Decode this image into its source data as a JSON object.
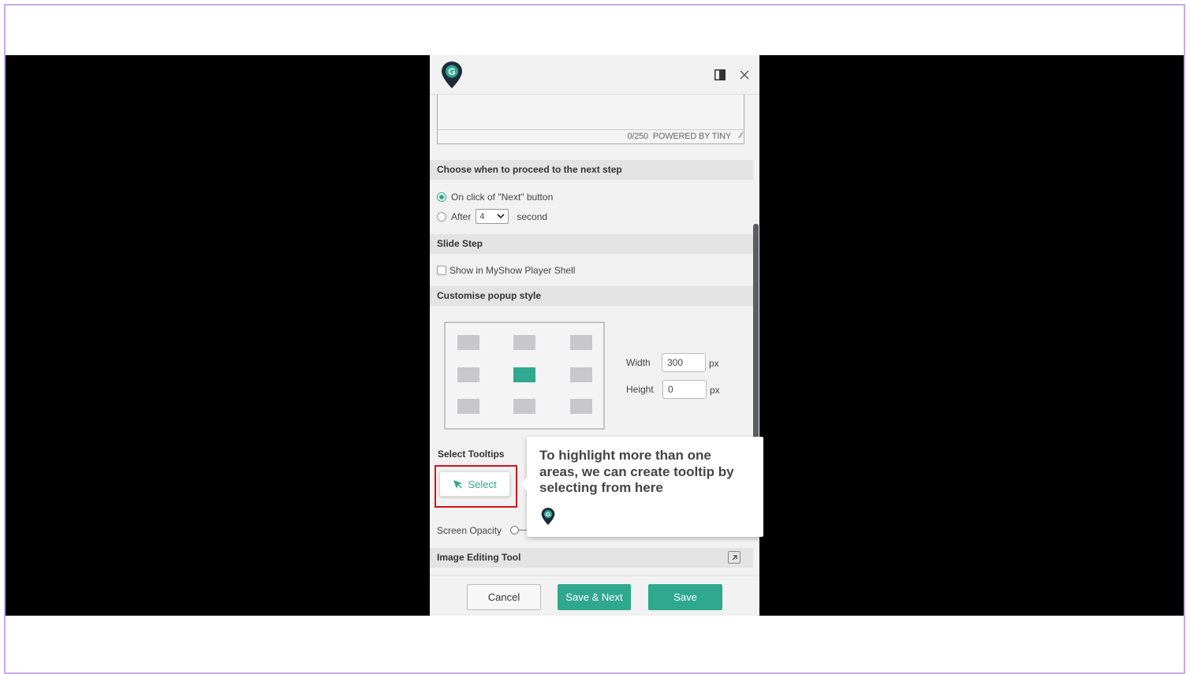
{
  "editor": {
    "char_count": "0/250",
    "powered_by": "POWERED BY TINY"
  },
  "proceed": {
    "heading": "Choose when to proceed to the next step",
    "option_next": "On click of \"Next\" button",
    "option_after": "After",
    "after_value": "4",
    "after_unit": "second"
  },
  "slide_step": {
    "heading": "Slide Step",
    "show_in_player": "Show in MyShow Player Shell"
  },
  "popup_style": {
    "heading": "Customise popup style",
    "width_label": "Width",
    "width_value": "300",
    "width_unit": "px",
    "height_label": "Height",
    "height_value": "0",
    "height_unit": "px"
  },
  "tooltips": {
    "heading": "Select Tooltips",
    "select_label": "Select"
  },
  "screen_opacity": {
    "label": "Screen Opacity"
  },
  "image_editing": {
    "heading": "Image Editing Tool"
  },
  "footer": {
    "cancel": "Cancel",
    "save_next": "Save & Next",
    "save": "Save"
  },
  "tooltip": {
    "text": "To highlight more than one areas, we can create tooltip by selecting from here"
  },
  "icons": {
    "logo": "map-pin-g-logo",
    "side_panel": "panel-toggle-icon",
    "close": "close-icon",
    "select": "cursor-pointer-icon",
    "external": "external-link-icon"
  },
  "colors": {
    "accent": "#2fa88e",
    "highlight": "#d0141c",
    "logo_dark": "#1f2b3a"
  }
}
